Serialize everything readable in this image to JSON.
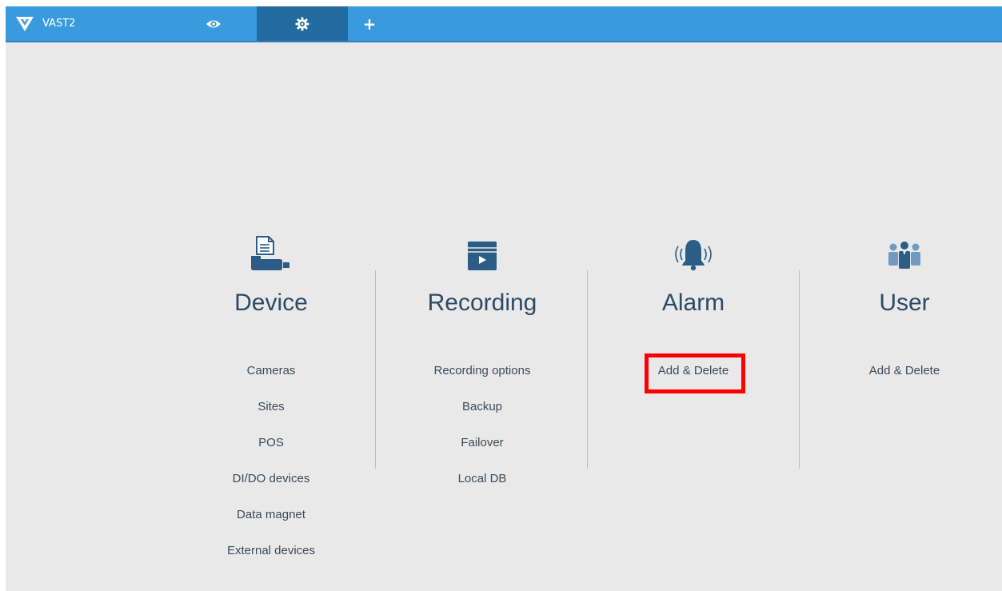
{
  "app": {
    "title": "VAST2"
  },
  "tabs": [
    {
      "name": "live-view",
      "icon": "eye-icon"
    },
    {
      "name": "settings",
      "icon": "gear-icon",
      "active": true
    },
    {
      "name": "add",
      "icon": "plus-icon",
      "label": "+"
    }
  ],
  "colors": {
    "topbar": "#3a9ade",
    "active_tab": "#236aa0",
    "background": "#e9e9e9",
    "icon": "#2b5d86",
    "highlight": "#ff0000"
  },
  "sections": [
    {
      "title": "Device",
      "icon": "device-icon",
      "links": [
        "Cameras",
        "Sites",
        "POS",
        "DI/DO devices",
        "Data magnet",
        "External devices"
      ]
    },
    {
      "title": "Recording",
      "icon": "recording-icon",
      "links": [
        "Recording options",
        "Backup",
        "Failover",
        "Local DB"
      ]
    },
    {
      "title": "Alarm",
      "icon": "alarm-bell-icon",
      "links": [
        "Add & Delete"
      ]
    },
    {
      "title": "User",
      "icon": "users-icon",
      "links": [
        "Add & Delete"
      ]
    }
  ]
}
